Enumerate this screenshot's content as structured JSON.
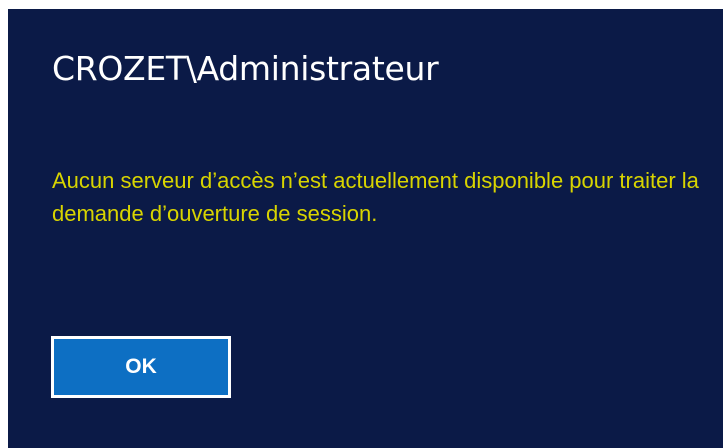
{
  "login": {
    "username": "CROZET\\Administrateur",
    "message": "Aucun serveur d’accès n’est actuellement disponible pour traiter la demande d’ouverture de session.",
    "ok_label": "OK"
  },
  "colors": {
    "background": "#0b1a47",
    "message_text": "#d8d400",
    "button_fill": "#0d6fc3",
    "button_border": "#ffffff"
  }
}
